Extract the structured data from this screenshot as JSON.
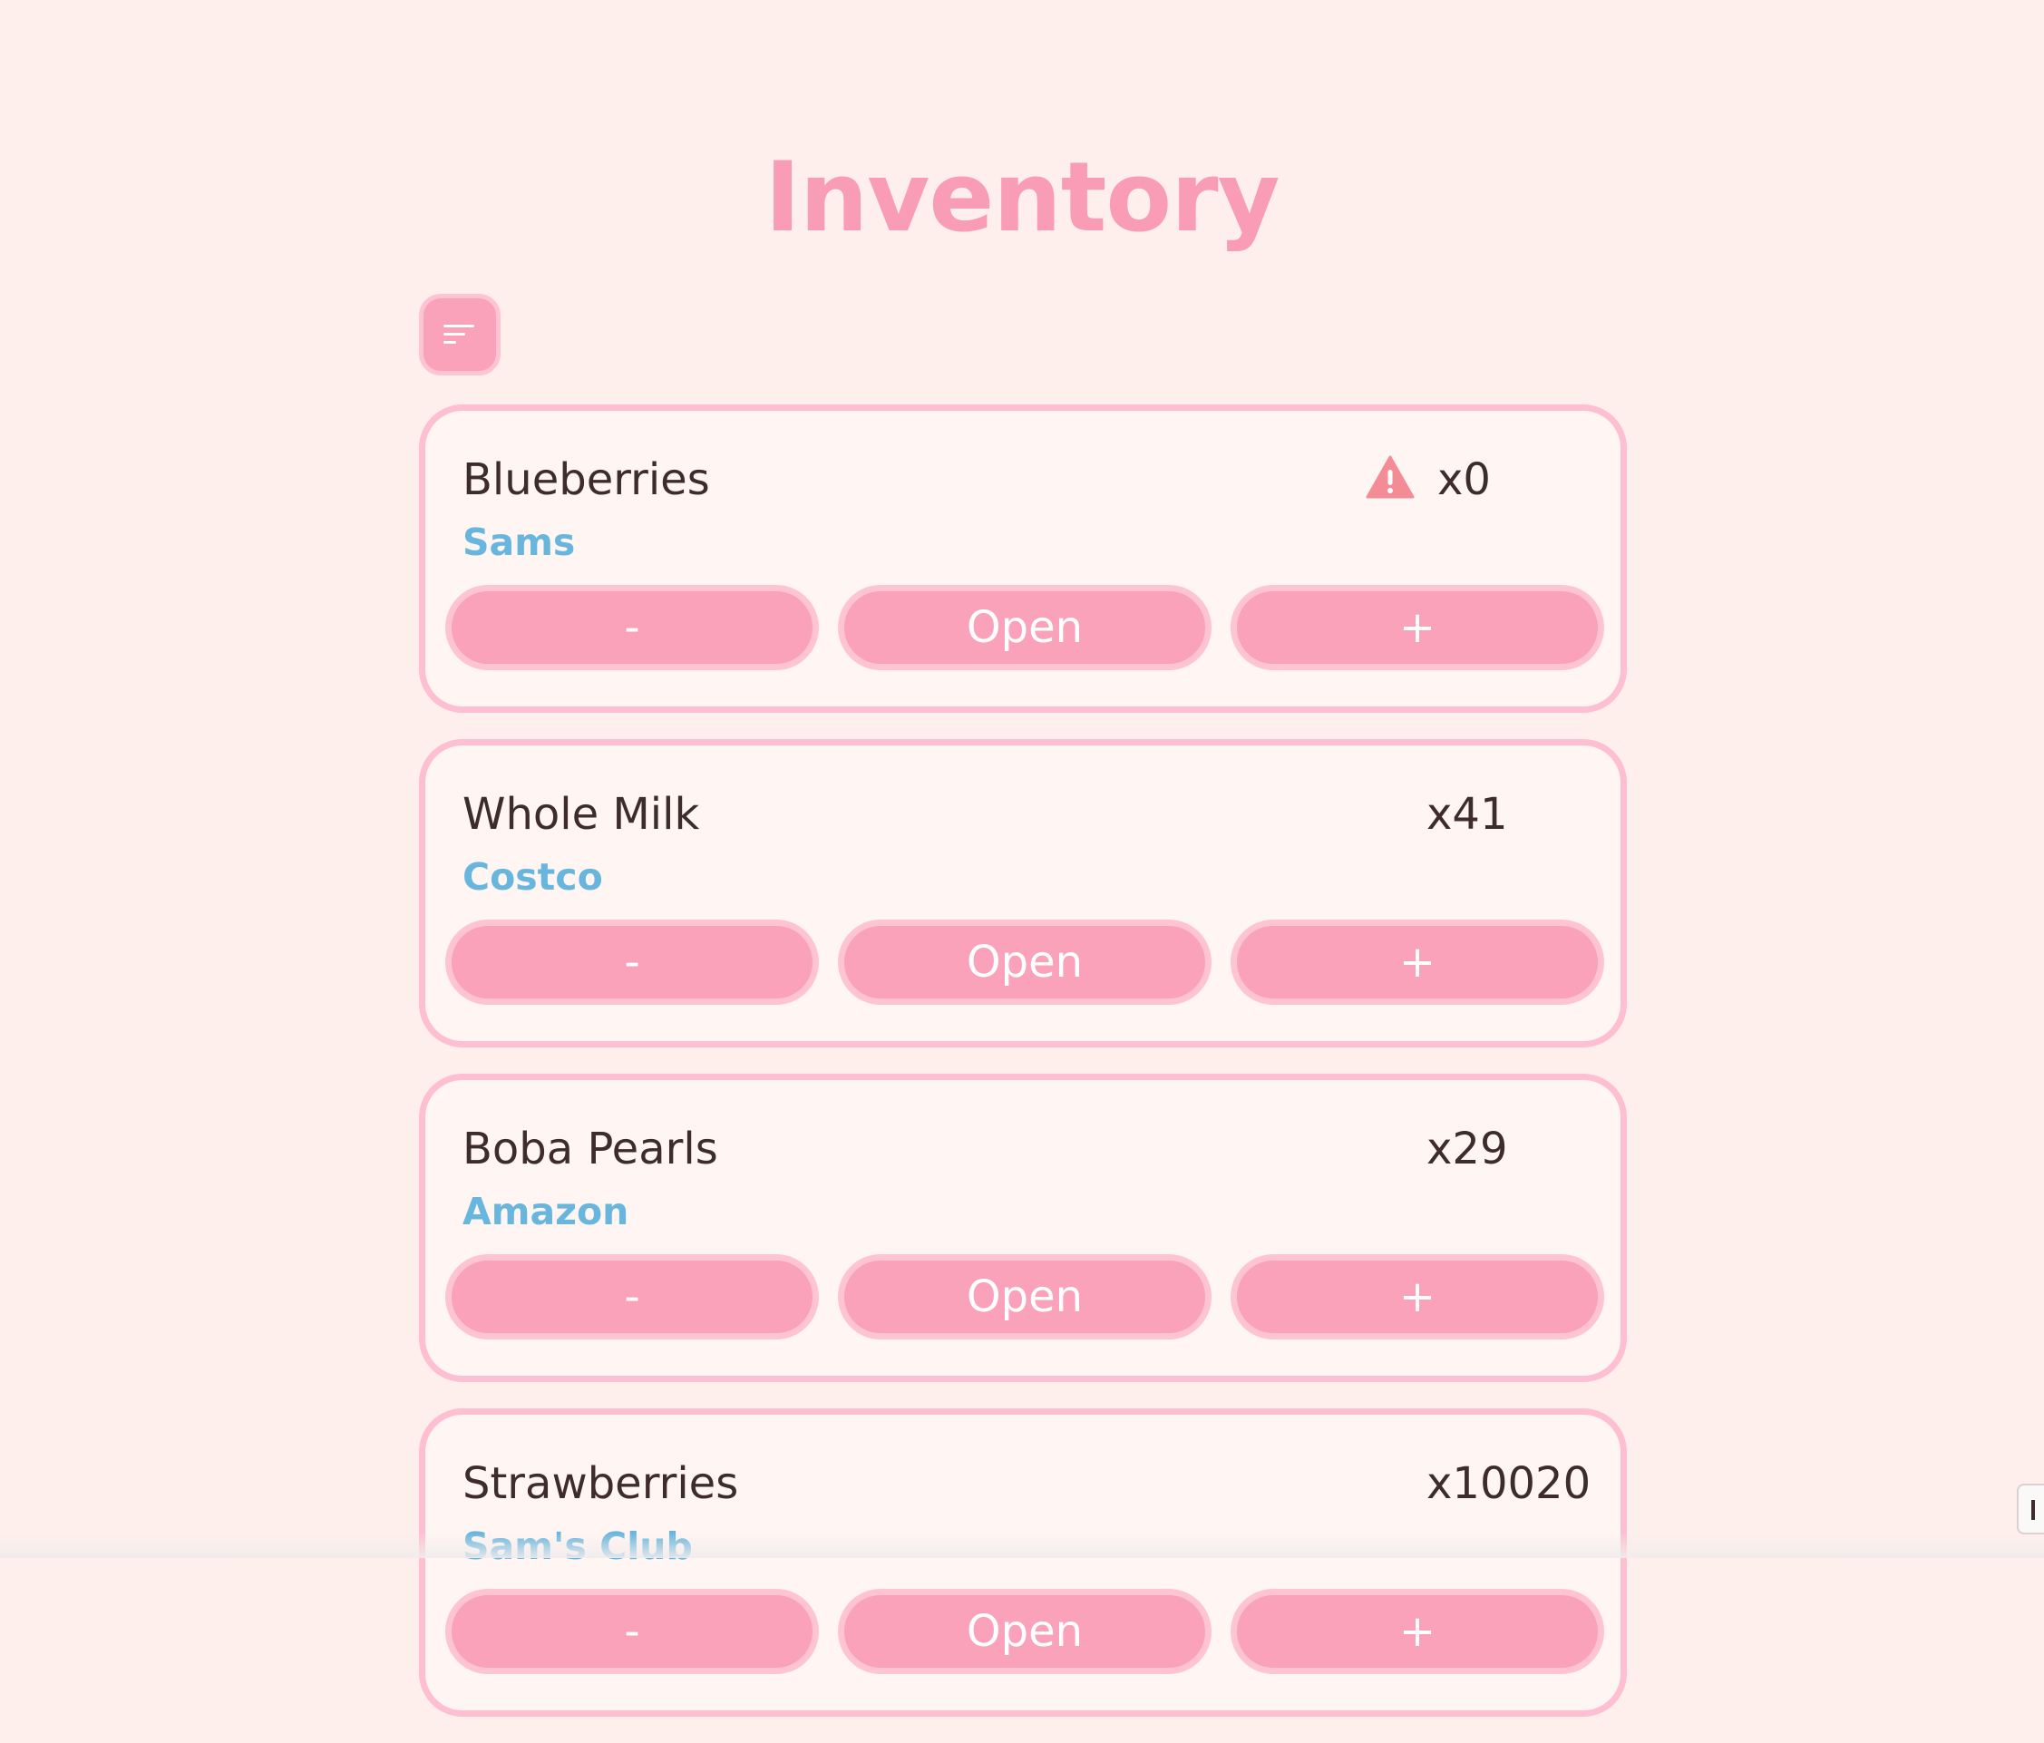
{
  "header": {
    "title": "Inventory"
  },
  "toolbar": {
    "sort_icon": "sort-lines-icon"
  },
  "items": [
    {
      "name": "Blueberries",
      "store": "Sams",
      "quantity": "x0",
      "warning": true,
      "warning_icon": "warning-triangle-icon",
      "decrement_label": "-",
      "open_label": "Open",
      "increment_label": "+"
    },
    {
      "name": "Whole Milk",
      "store": "Costco",
      "quantity": "x41",
      "warning": false,
      "decrement_label": "-",
      "open_label": "Open",
      "increment_label": "+"
    },
    {
      "name": "Boba Pearls",
      "store": "Amazon",
      "quantity": "x29",
      "warning": false,
      "decrement_label": "-",
      "open_label": "Open",
      "increment_label": "+"
    },
    {
      "name": "Strawberries",
      "store": "Sam's Club",
      "quantity": "x10020",
      "warning": false,
      "decrement_label": "-",
      "open_label": "Open",
      "increment_label": "+"
    }
  ],
  "colors": {
    "background": "#ffefec",
    "accent_pink": "#f99cb6",
    "button_fill": "#f9a2ba",
    "card_border": "#fdbfd1",
    "store_text": "#68b6dd",
    "warning": "#f48c96"
  }
}
